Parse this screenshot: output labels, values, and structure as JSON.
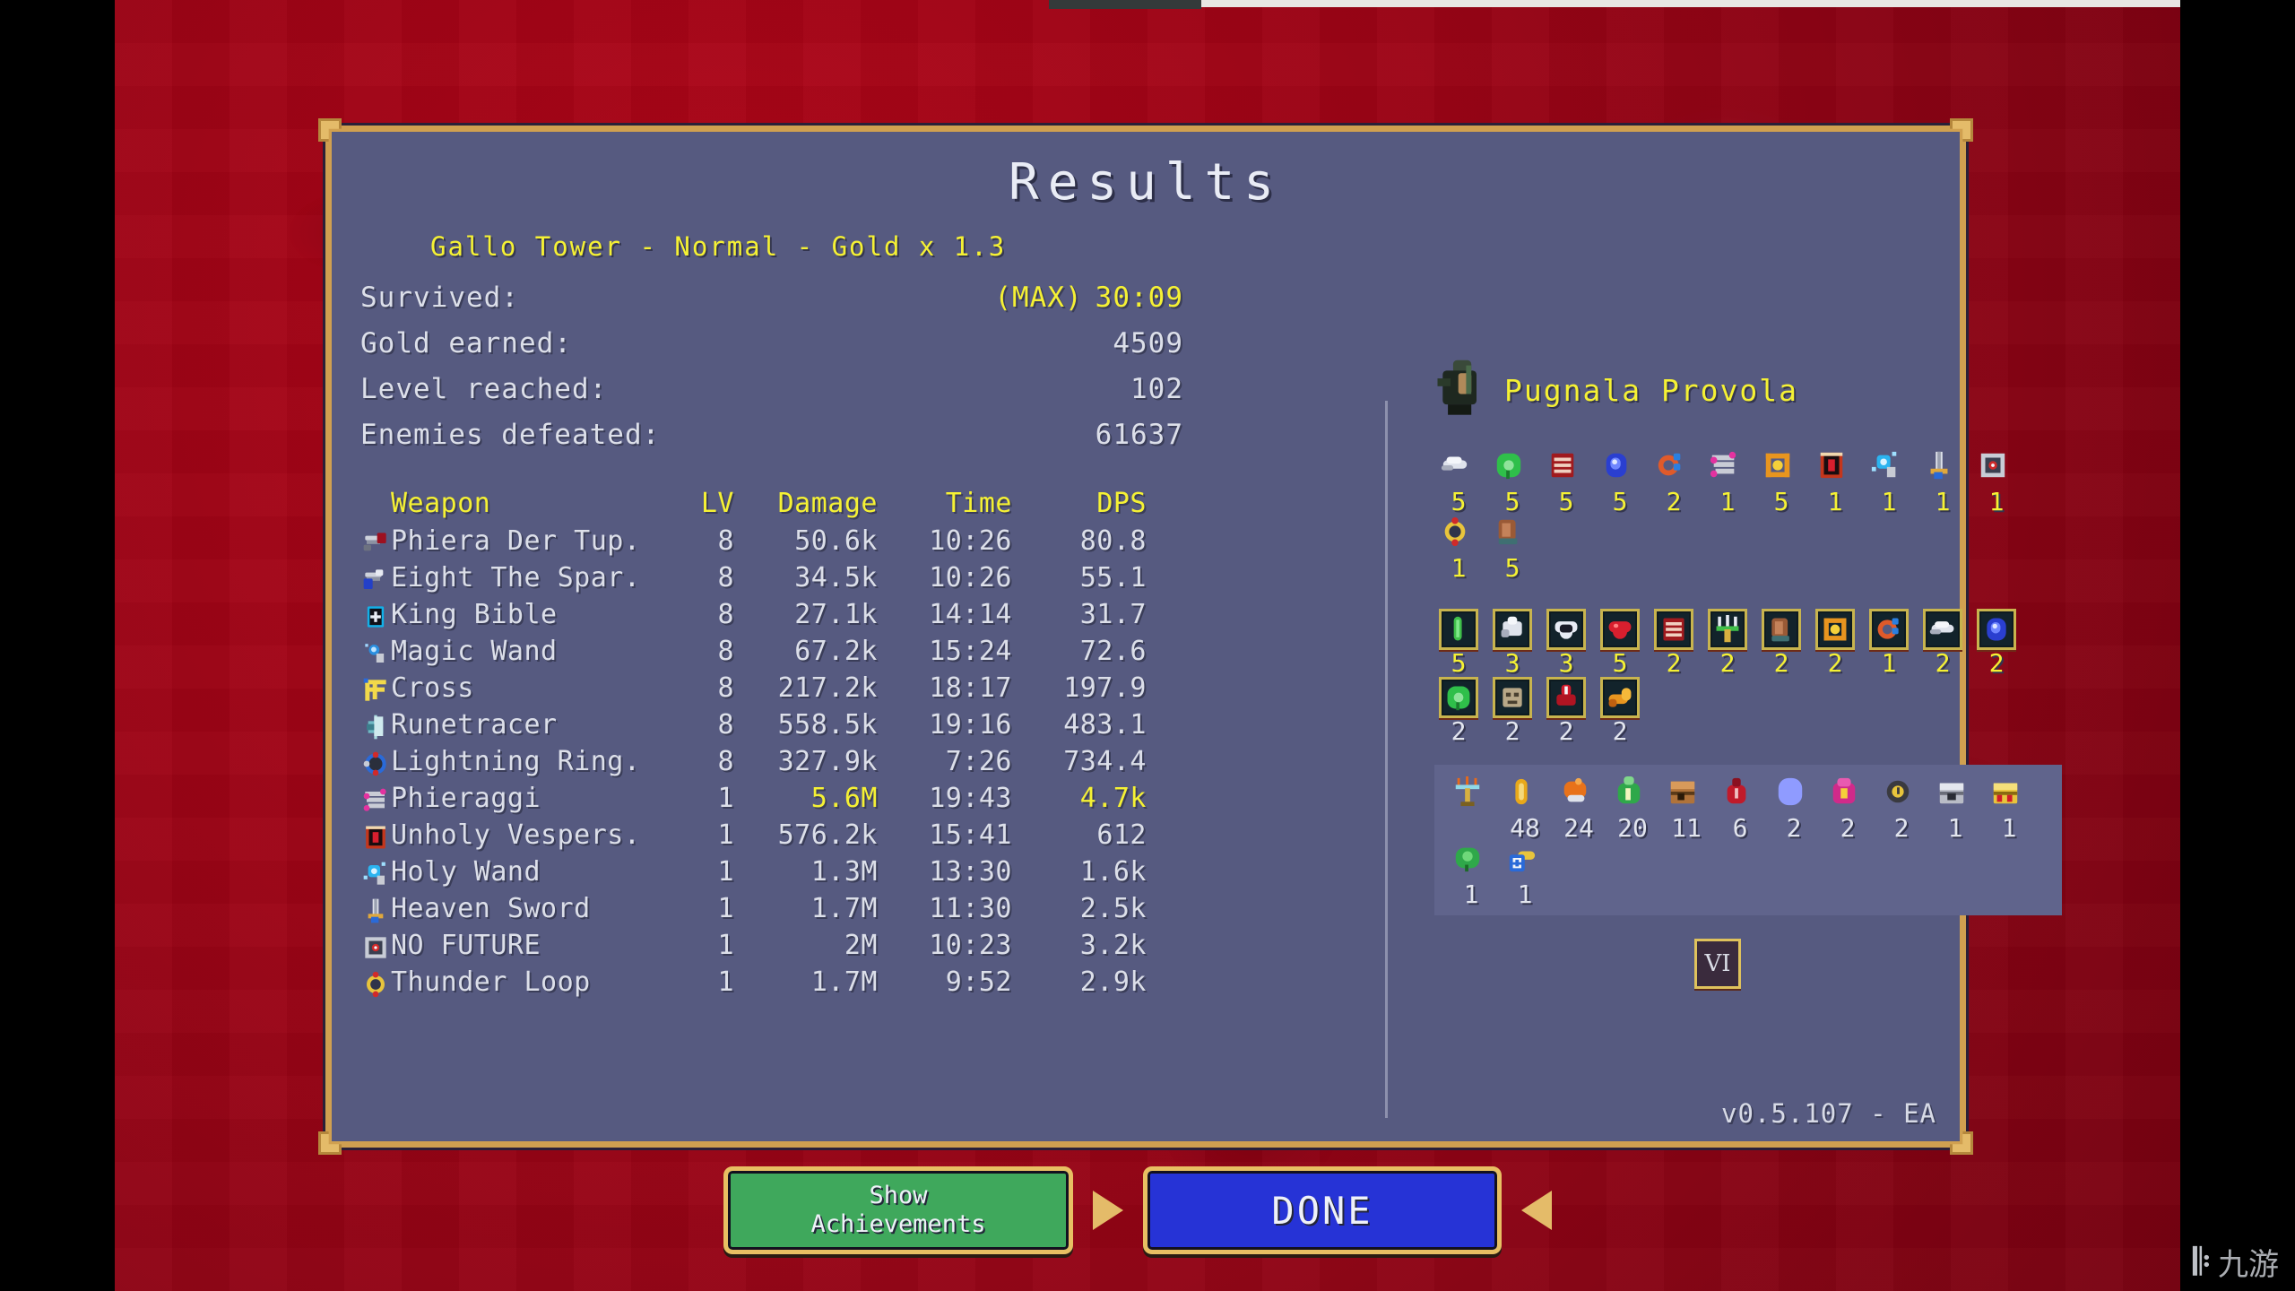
{
  "window": {
    "title": "Results",
    "version": "v0.5.107 - EA",
    "watermark": "九游"
  },
  "header": {
    "stage_line": "Gallo Tower - Normal - Gold x 1.3"
  },
  "stats": [
    {
      "label": "Survived:",
      "max_tag": "(MAX)",
      "value": "30:09",
      "highlight": true
    },
    {
      "label": "Gold earned:",
      "max_tag": "",
      "value": "4509",
      "highlight": false
    },
    {
      "label": "Level reached:",
      "max_tag": "",
      "value": "102",
      "highlight": false
    },
    {
      "label": "Enemies defeated:",
      "max_tag": "",
      "value": "61637",
      "highlight": false
    }
  ],
  "weapon_table": {
    "columns": [
      "Weapon",
      "LV",
      "Damage",
      "Time",
      "DPS"
    ],
    "rows": [
      {
        "icon": "phiera-der-tuphello-icon",
        "name": "Phiera Der Tup.",
        "lv": "8",
        "damage": "50.6k",
        "time": "10:26",
        "dps": "80.8",
        "highlight": false
      },
      {
        "icon": "eight-the-sparrow-icon",
        "name": "Eight The Spar.",
        "lv": "8",
        "damage": "34.5k",
        "time": "10:26",
        "dps": "55.1",
        "highlight": false
      },
      {
        "icon": "king-bible-icon",
        "name": "King Bible",
        "lv": "8",
        "damage": "27.1k",
        "time": "14:14",
        "dps": "31.7",
        "highlight": false
      },
      {
        "icon": "magic-wand-icon",
        "name": "Magic Wand",
        "lv": "8",
        "damage": "67.2k",
        "time": "15:24",
        "dps": "72.6",
        "highlight": false
      },
      {
        "icon": "cross-icon",
        "name": "Cross",
        "lv": "8",
        "damage": "217.2k",
        "time": "18:17",
        "dps": "197.9",
        "highlight": false
      },
      {
        "icon": "runetracer-icon",
        "name": "Runetracer",
        "lv": "8",
        "damage": "558.5k",
        "time": "19:16",
        "dps": "483.1",
        "highlight": false
      },
      {
        "icon": "lightning-ring-icon",
        "name": "Lightning Ring.",
        "lv": "8",
        "damage": "327.9k",
        "time": "7:26",
        "dps": "734.4",
        "highlight": false
      },
      {
        "icon": "phieraggi-icon",
        "name": "Phieraggi",
        "lv": "1",
        "damage": "5.6M",
        "time": "19:43",
        "dps": "4.7k",
        "highlight": true
      },
      {
        "icon": "unholy-vespers-icon",
        "name": "Unholy Vespers.",
        "lv": "1",
        "damage": "576.2k",
        "time": "15:41",
        "dps": "612",
        "highlight": false
      },
      {
        "icon": "holy-wand-icon",
        "name": "Holy Wand",
        "lv": "1",
        "damage": "1.3M",
        "time": "13:30",
        "dps": "1.6k",
        "highlight": false
      },
      {
        "icon": "heaven-sword-icon",
        "name": "Heaven Sword",
        "lv": "1",
        "damage": "1.7M",
        "time": "11:30",
        "dps": "2.5k",
        "highlight": false
      },
      {
        "icon": "no-future-icon",
        "name": "NO FUTURE",
        "lv": "1",
        "damage": "2M",
        "time": "10:23",
        "dps": "3.2k",
        "highlight": false
      },
      {
        "icon": "thunder-loop-icon",
        "name": "Thunder Loop",
        "lv": "1",
        "damage": "1.7M",
        "time": "9:52",
        "dps": "2.9k",
        "highlight": false
      }
    ]
  },
  "character": {
    "name": "Pugnala Provola",
    "sprite": "character-sprite-icon"
  },
  "equipment": [
    {
      "icon": "wings-icon",
      "count": "5",
      "color": "yellow"
    },
    {
      "icon": "clover-icon",
      "count": "5",
      "color": "yellow"
    },
    {
      "icon": "red-book-icon",
      "count": "5",
      "color": "yellow"
    },
    {
      "icon": "blue-orb-icon",
      "count": "5",
      "color": "yellow"
    },
    {
      "icon": "ring-icon",
      "count": "2",
      "color": "yellow"
    },
    {
      "icon": "phieraggi-icon",
      "count": "1",
      "color": "yellow"
    },
    {
      "icon": "crossbones-icon",
      "count": "5",
      "color": "yellow"
    },
    {
      "icon": "unholy-vespers-icon",
      "count": "1",
      "color": "yellow"
    },
    {
      "icon": "holy-wand-icon",
      "count": "1",
      "color": "yellow"
    },
    {
      "icon": "heaven-sword-icon",
      "count": "1",
      "color": "yellow"
    },
    {
      "icon": "no-future-icon",
      "count": "1",
      "color": "yellow"
    },
    {
      "icon": "thunder-loop-icon",
      "count": "1",
      "color": "yellow"
    },
    {
      "icon": "glove-icon",
      "count": "5",
      "color": "yellow"
    }
  ],
  "passives": [
    {
      "icon": "spinach-leaf-icon",
      "count": "5",
      "color": "yellow"
    },
    {
      "icon": "white-armor-icon",
      "count": "3",
      "color": "yellow"
    },
    {
      "icon": "hollow-heart-icon",
      "count": "3",
      "color": "yellow"
    },
    {
      "icon": "red-heart-icon",
      "count": "5",
      "color": "yellow"
    },
    {
      "icon": "red-book-icon",
      "count": "2",
      "color": "yellow"
    },
    {
      "icon": "candelabrador-icon",
      "count": "2",
      "color": "yellow"
    },
    {
      "icon": "glove-icon",
      "count": "2",
      "color": "yellow"
    },
    {
      "icon": "crossbones-icon",
      "count": "2",
      "color": "yellow"
    },
    {
      "icon": "ring-icon",
      "count": "1",
      "color": "yellow"
    },
    {
      "icon": "wings-icon",
      "count": "2",
      "color": "yellow"
    },
    {
      "icon": "blue-orb-icon",
      "count": "2",
      "color": "yellow"
    },
    {
      "icon": "clover-icon",
      "count": "2",
      "color": "white"
    },
    {
      "icon": "stone-mask-icon",
      "count": "2",
      "color": "white"
    },
    {
      "icon": "red-cape-icon",
      "count": "2",
      "color": "white"
    },
    {
      "icon": "orange-horn-icon",
      "count": "2",
      "color": "white"
    }
  ],
  "pickups": [
    {
      "icon": "candelabra-icon",
      "count": "",
      "color": "white"
    },
    {
      "icon": "gold-coin-icon",
      "count": "48",
      "color": "white"
    },
    {
      "icon": "roast-chicken-icon",
      "count": "24",
      "color": "white"
    },
    {
      "icon": "money-bag-icon",
      "count": "20",
      "color": "white"
    },
    {
      "icon": "wood-chest-icon",
      "count": "11",
      "color": "white"
    },
    {
      "icon": "red-pouch-icon",
      "count": "6",
      "color": "white"
    },
    {
      "icon": "blue-gem-icon",
      "count": "2",
      "color": "white"
    },
    {
      "icon": "pink-bag-icon",
      "count": "2",
      "color": "white"
    },
    {
      "icon": "clock-icon",
      "count": "2",
      "color": "white"
    },
    {
      "icon": "silver-chest-icon",
      "count": "1",
      "color": "white"
    },
    {
      "icon": "gold-chest-icon",
      "count": "1",
      "color": "white"
    },
    {
      "icon": "green-clover-icon",
      "count": "1",
      "color": "white"
    },
    {
      "icon": "rosary-icon",
      "count": "1",
      "color": "white"
    }
  ],
  "arcana": {
    "label": "VI"
  },
  "buttons": {
    "achievements_line1": "Show",
    "achievements_line2": "Achievements",
    "done": "DONE"
  }
}
